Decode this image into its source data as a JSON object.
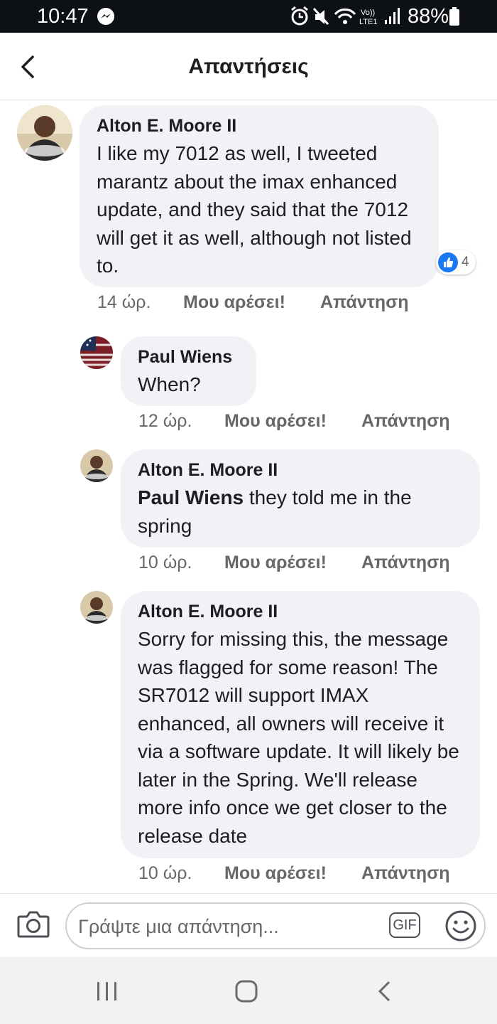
{
  "status_bar": {
    "time": "10:47",
    "battery": "88%",
    "icons": [
      "messenger-icon",
      "alarm-icon",
      "mute-icon",
      "wifi-icon",
      "volte-icon",
      "signal-icon",
      "battery-icon"
    ]
  },
  "header": {
    "title": "Απαντήσεις",
    "back_icon": "chevron-left-icon"
  },
  "comments": [
    {
      "author": "Alton E. Moore II",
      "text": "I like my 7012 as well, I tweeted marantz about the imax enhanced update, and they said that the 7012 will get it as well, although not listed to.",
      "time": "14 ώρ.",
      "like_label": "Μου αρέσει!",
      "reply_label": "Απάντηση",
      "reaction_count": "4"
    },
    {
      "author": "Paul Wiens",
      "text": "When?",
      "time": "12 ώρ.",
      "like_label": "Μου αρέσει!",
      "reply_label": "Απάντηση"
    },
    {
      "author": "Alton E. Moore II",
      "mention": "Paul Wiens",
      "text": " they told me in the spring",
      "time": "10 ώρ.",
      "like_label": "Μου αρέσει!",
      "reply_label": "Απάντηση"
    },
    {
      "author": "Alton E. Moore II",
      "text": "Sorry for missing this, the message was flagged for some reason! The SR7012 will support IMAX enhanced, all owners will receive it via a software update. It will likely be later in the Spring. We'll release more info once we get closer to the release date",
      "time": "10 ώρ.",
      "like_label": "Μου αρέσει!",
      "reply_label": "Απάντηση"
    }
  ],
  "composer": {
    "placeholder": "Γράψτε μια απάντηση...",
    "gif_label": "GIF"
  },
  "colors": {
    "bubble": "#f0f2f5",
    "like_blue": "#1877f2",
    "meta_text": "#65676b",
    "status_bar": "#0d1014"
  }
}
